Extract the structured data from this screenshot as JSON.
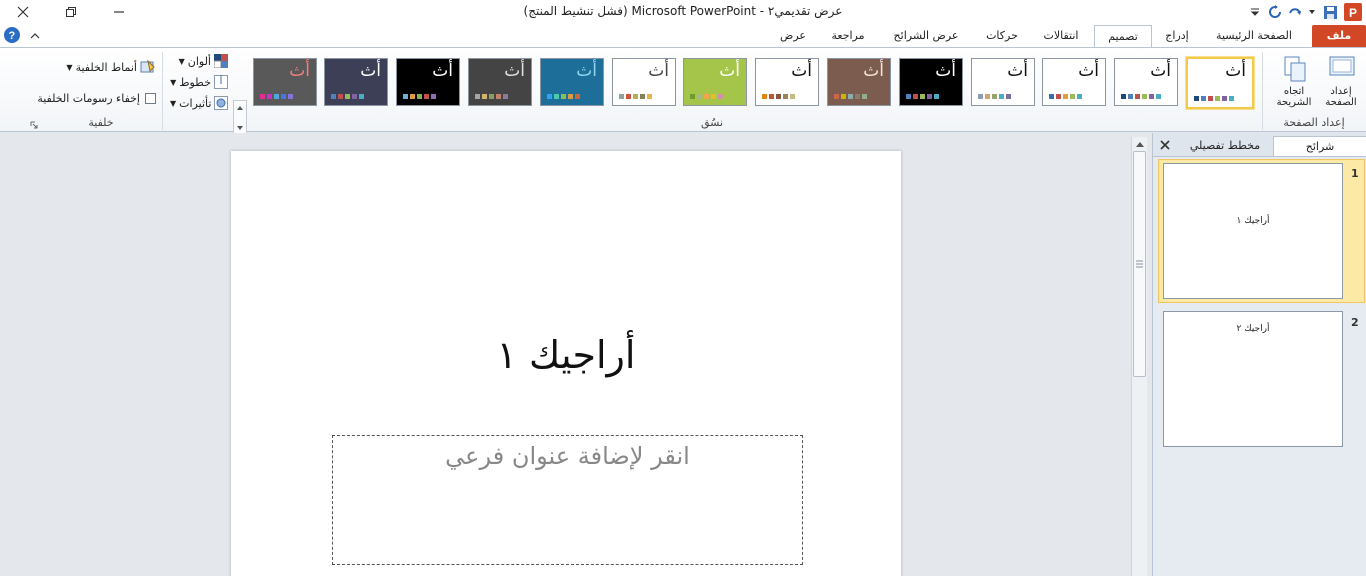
{
  "window": {
    "title": "عرض تقديمي٢ - Microsoft PowerPoint (فشل تنشيط المنتج)"
  },
  "tabs": [
    {
      "id": "file",
      "label": "ملف"
    },
    {
      "id": "home",
      "label": "الصفحة الرئيسية"
    },
    {
      "id": "insert",
      "label": "إدراج"
    },
    {
      "id": "design",
      "label": "تصميم"
    },
    {
      "id": "transitions",
      "label": "انتقالات"
    },
    {
      "id": "animations",
      "label": "حركات"
    },
    {
      "id": "slideshow",
      "label": "عرض الشرائح"
    },
    {
      "id": "review",
      "label": "مراجعة"
    },
    {
      "id": "view",
      "label": "عرض"
    }
  ],
  "ribbon": {
    "page_setup": {
      "group_label": "إعداد الصفحة",
      "page_setup_button": "إعداد الصفحة",
      "orientation_button": "اتجاه الشريحة"
    },
    "themes": {
      "group_label": "نسُق",
      "theme_glyph": "أث",
      "items": [
        {
          "bg": "#ffffff",
          "fg": "#111111",
          "selected": true,
          "sw": [
            "#1f497d",
            "#4f81bd",
            "#c0504d",
            "#9bbb59",
            "#8064a2",
            "#4bacc6"
          ]
        },
        {
          "bg": "#ffffff",
          "fg": "#111111",
          "sw": [
            "#1f497d",
            "#4f81bd",
            "#c0504d",
            "#9bbb59",
            "#8064a2",
            "#4bacc6"
          ]
        },
        {
          "bg": "#ffffff",
          "fg": "#111111",
          "sw": [
            "#3d6da5",
            "#c0504d",
            "#e39c3b",
            "#9bbb59",
            "#4bacc6"
          ]
        },
        {
          "bg": "#ffffff",
          "fg": "#111111",
          "sw": [
            "#8d9db1",
            "#d2a46e",
            "#97a56b",
            "#4bacc6",
            "#7c6e9d"
          ]
        },
        {
          "bg": "#000000",
          "fg": "#ffffff",
          "sw": [
            "#4f81bd",
            "#c0504d",
            "#9bbb59",
            "#8064a2",
            "#4bacc6"
          ]
        },
        {
          "bg": "#7b5c4e",
          "fg": "#f3e6d8",
          "sw": [
            "#d16349",
            "#ccb400",
            "#8cadae",
            "#8c7b70",
            "#8fb08c"
          ]
        },
        {
          "bg": "#ffffff",
          "fg": "#111111",
          "sw": [
            "#e48312",
            "#bd582c",
            "#865640",
            "#9b8357",
            "#c2bc80"
          ]
        },
        {
          "bg": "#a4c549",
          "fg": "#ffffff",
          "sw": [
            "#6f9a2e",
            "#a5b592",
            "#f3a447",
            "#e7bc29",
            "#d092a7"
          ]
        },
        {
          "bg": "#ffffff",
          "fg": "#444444",
          "sw": [
            "#93a299",
            "#cf543f",
            "#b5ae53",
            "#848058",
            "#e8b54d"
          ]
        },
        {
          "bg": "#1d6f9a",
          "fg": "#8fd7f0",
          "sw": [
            "#2fa3ee",
            "#4bcaad",
            "#86c157",
            "#d99c3f",
            "#ce6633"
          ]
        },
        {
          "bg": "#444444",
          "fg": "#e0e0e0",
          "sw": [
            "#a5a5a5",
            "#d2b56c",
            "#8d9d64",
            "#c4816a",
            "#8c7a9a"
          ]
        },
        {
          "bg": "#000000",
          "fg": "#ffffff",
          "sw": [
            "#6eb0d4",
            "#e29a3e",
            "#88b04b",
            "#c3504f",
            "#8c6fb0"
          ]
        },
        {
          "bg": "#3c3f55",
          "fg": "#ffffff",
          "sw": [
            "#4f81bd",
            "#c0504d",
            "#9bbb59",
            "#8064a2",
            "#4bacc6"
          ]
        },
        {
          "bg": "#595959",
          "fg": "#f08080",
          "sw": [
            "#e32d91",
            "#c830cc",
            "#4ea6dc",
            "#4775e7",
            "#8971e1"
          ]
        }
      ]
    },
    "background": {
      "group_label": "خلفية",
      "colors": "ألوان",
      "fonts": "خطوط",
      "effects": "تأثيرات",
      "styles": "أنماط الخلفية",
      "hide_graphics": "إخفاء رسومات الخلفية"
    }
  },
  "slide": {
    "title": "أراجيك ١",
    "subtitle_placeholder": "انقر لإضافة عنوان فرعي"
  },
  "pane": {
    "tab_slides": "شرائح",
    "tab_outline": "مخطط تفصيلي",
    "slides": [
      {
        "number": "1",
        "title": "أراجيك ١"
      },
      {
        "number": "2",
        "title": "أراجيك ٢"
      }
    ]
  },
  "colors": {
    "file_tab": "#d24726",
    "selection": "#f2c94c"
  }
}
